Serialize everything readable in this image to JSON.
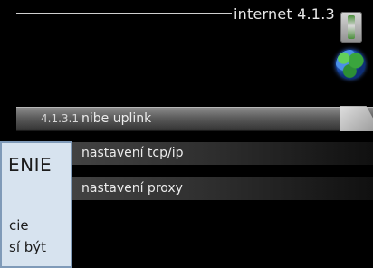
{
  "header": {
    "title": "internet 4.1.3",
    "device_icon": "thermostat-icon",
    "globe_icon": "globe-icon"
  },
  "menu": {
    "items": [
      {
        "index": "4.1.3.1",
        "label": "nibe uplink",
        "selected": true
      },
      {
        "index": "",
        "label": "nastavení tcp/ip",
        "selected": false
      },
      {
        "index": "",
        "label": "nastavení proxy",
        "selected": false
      }
    ]
  },
  "info_box": {
    "title": "ENIE",
    "line1": "cie",
    "line2": "sí být"
  }
}
